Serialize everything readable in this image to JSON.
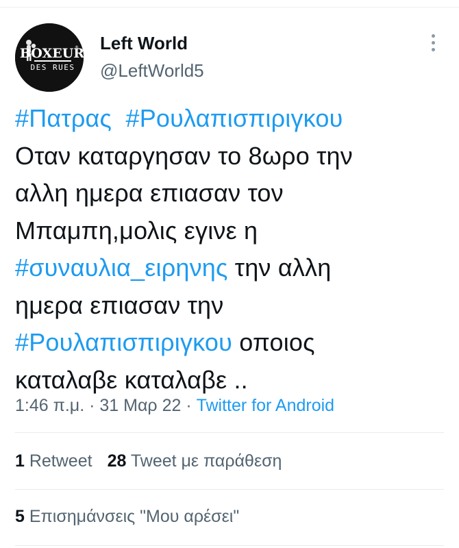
{
  "author": {
    "display_name": "Left World",
    "handle": "@LeftWorld5",
    "avatar_logo_text": [
      "BOXEUR",
      "DES RUES"
    ]
  },
  "tweet": {
    "lines": [
      [
        {
          "text": "#Πατρας",
          "hashtag": true
        },
        {
          "text": "  ",
          "hashtag": false
        },
        {
          "text": "#Ρουλαπισπιριγκου",
          "hashtag": true
        }
      ],
      [
        {
          "text": "Οταν καταργησαν το 8ωρο την",
          "hashtag": false
        }
      ],
      [
        {
          "text": "αλλη ημερα επιασαν τον",
          "hashtag": false
        }
      ],
      [
        {
          "text": "Μπαμπη,μολις εγινε η",
          "hashtag": false
        }
      ],
      [
        {
          "text": "#συναυλια_ειρηνης",
          "hashtag": true
        },
        {
          "text": " την αλλη",
          "hashtag": false
        }
      ],
      [
        {
          "text": "ημερα επιασαν την",
          "hashtag": false
        }
      ],
      [
        {
          "text": "#Ρουλαπισπιριγκου",
          "hashtag": true
        },
        {
          "text": " οποιος",
          "hashtag": false
        }
      ],
      [
        {
          "text": "καταλαβε καταλαβε ..",
          "hashtag": false
        }
      ]
    ]
  },
  "meta": {
    "time": "1:46 π.μ.",
    "separator": " · ",
    "date": "31 Μαρ 22",
    "source": "Twitter for Android"
  },
  "stats": {
    "retweets": {
      "count": "1",
      "label": " Retweet"
    },
    "quotes": {
      "count": "28",
      "label": " Tweet με παράθεση"
    },
    "likes": {
      "count": "5",
      "label": " Επισημάνσεις \"Μου αρέσει\""
    }
  },
  "colors": {
    "hashtag": "#1d9bf0",
    "secondary_text": "#536471",
    "primary_text": "#0f1419"
  }
}
